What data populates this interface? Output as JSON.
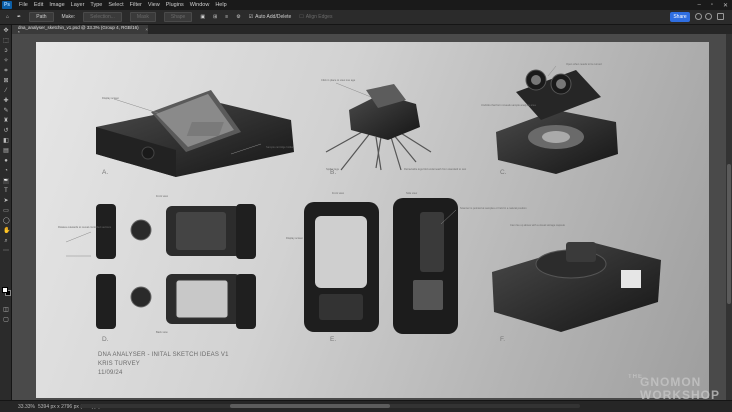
{
  "app": {
    "logo": "Ps"
  },
  "menu": [
    "File",
    "Edit",
    "Image",
    "Layer",
    "Type",
    "Select",
    "Filter",
    "View",
    "Plugins",
    "Window",
    "Help"
  ],
  "options": {
    "path_mode": "Path",
    "make_label": "Make:",
    "selection": "Selection...",
    "mask": "Mask",
    "shape": "Shape",
    "auto_add_delete": "Auto Add/Delete",
    "align_edges": "Align Edges"
  },
  "share_label": "Share",
  "document_tab": {
    "title": "dna_analyser_sketchin_v1.psd @ 33.3% (Group 4, RGB/16) *",
    "close": "×"
  },
  "status": {
    "zoom": "33.33%",
    "doc_info": "5394 px x 2796 px (300 ppi)"
  },
  "sketch": {
    "letters": [
      "A.",
      "B.",
      "C.",
      "D.",
      "E.",
      "F."
    ],
    "labels": {
      "a_display": "Display screen",
      "a_cartridge": "Sample cartridge holder",
      "b_top": "Click in place to view one age",
      "b_legs": "Spider legs",
      "b_leg_note": "Retractable legs fold underneath from standard to rest",
      "c_top": "Open when needs to be turned",
      "c_note": "Unclicks that form reveals sample analysis area",
      "d_front": "Front view",
      "d_side": "Rotates outwards to reveal controlled sections",
      "d_back": "Back view",
      "e_front": "Front view",
      "e_side": "Side view",
      "e_display": "Display screen",
      "e_note": "Scanner is pointed at samples or held in a natural position",
      "f_note": "Can rise up above with a visual storage capsule"
    },
    "caption": [
      "DNA ANALYSER - INITAL SKETCH IDEAS V1",
      "KRIS TURVEY",
      "11/09/24"
    ],
    "watermark": [
      "THE",
      "GNOMON",
      "WORKSHOP"
    ]
  }
}
